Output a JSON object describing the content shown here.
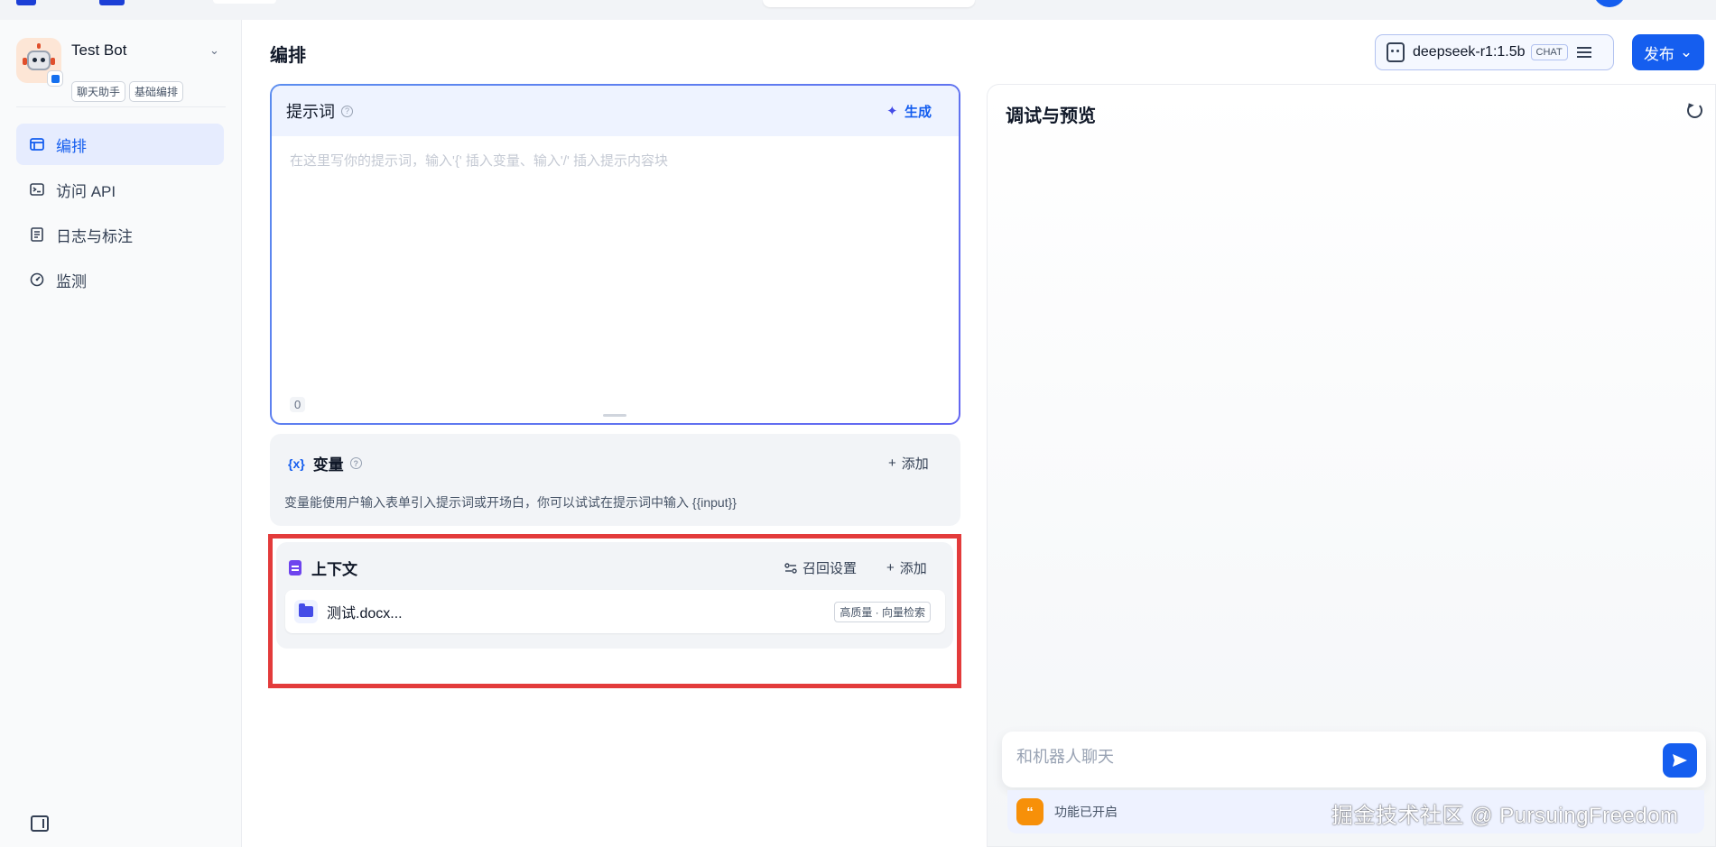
{
  "app": {
    "name": "Test Bot",
    "tags": [
      "聊天助手",
      "基础编排"
    ]
  },
  "nav": {
    "items": [
      {
        "label": "编排",
        "icon": "layout-icon",
        "active": true
      },
      {
        "label": "访问 API",
        "icon": "terminal-icon",
        "active": false
      },
      {
        "label": "日志与标注",
        "icon": "log-icon",
        "active": false
      },
      {
        "label": "监测",
        "icon": "gauge-icon",
        "active": false
      }
    ]
  },
  "header": {
    "title": "编排",
    "model_name": "deepseek-r1:1.5b",
    "model_mode": "CHAT",
    "publish_label": "发布"
  },
  "prompt": {
    "title": "提示词",
    "generate_label": "生成",
    "placeholder": "在这里写你的提示词，输入'{' 插入变量、输入'/' 插入提示内容块",
    "char_count": "0"
  },
  "variables": {
    "icon_text": "{x}",
    "title": "变量",
    "add_label": "添加",
    "description": "变量能使用户输入表单引入提示词或开场白，你可以试试在提示词中输入 {{input}}"
  },
  "context": {
    "title": "上下文",
    "recall_label": "召回设置",
    "add_label": "添加",
    "datasets": [
      {
        "name": "测试.docx...",
        "badge": "高质量 · 向量检索"
      }
    ]
  },
  "debug": {
    "title": "调试与预览",
    "chat_placeholder": "和机器人聊天",
    "feature_label": "功能已开启"
  },
  "watermark": "掘金技术社区 @ PursuingFreedom",
  "colors": {
    "accent": "#155eef",
    "highlight_border": "#e33b3b"
  }
}
